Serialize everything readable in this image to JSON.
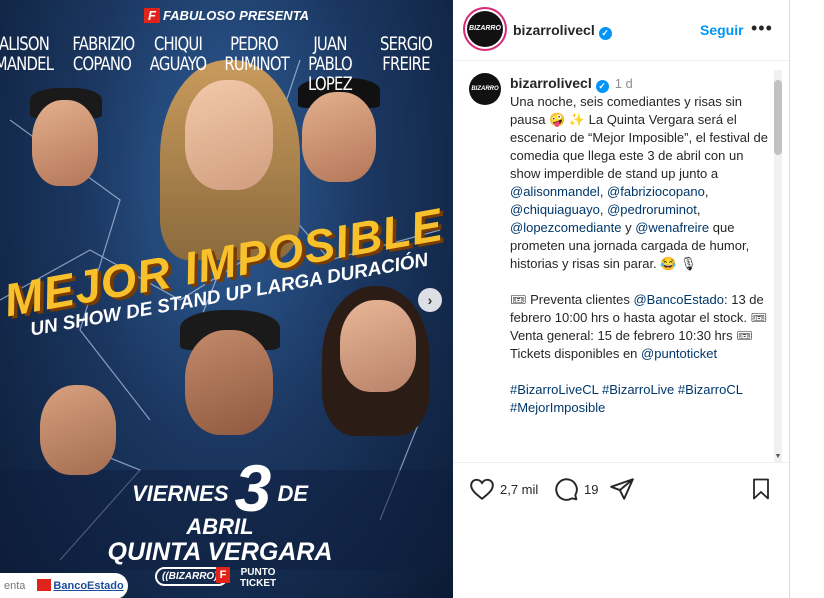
{
  "poster": {
    "sponsor_logo": "F",
    "sponsor_name": "FABULOSO",
    "sponsor_suffix": "PRESENTA",
    "comedians": [
      {
        "line1": "ALISON",
        "line2": "MANDEL"
      },
      {
        "line1": "FABRIZIO",
        "line2": "COPANO"
      },
      {
        "line1": "CHIQUI",
        "line2": "AGUAYO"
      },
      {
        "line1": "PEDRO",
        "line2": "RUMINOT"
      },
      {
        "line1": "JUAN PABLO",
        "line2": "LOPEZ"
      },
      {
        "line1": "SERGIO",
        "line2": "FREIRE"
      }
    ],
    "title": "MEJOR IMPOSIBLE",
    "subtitle": "UN SHOW DE STAND UP LARGA DURACIÓN",
    "date_day_name": "VIERNES",
    "date_number": "3",
    "date_month": "DE ABRIL",
    "venue": "QUINTA VERGARA",
    "sponsor_bar": {
      "entrance_text": "enta",
      "bank": "BancoEstado",
      "bizarro": "((BIZARRO))",
      "fabuloso_short": "F",
      "punto": "PUNTO",
      "ticket": "TICKET"
    },
    "next_arrow": "›"
  },
  "header": {
    "avatar_text": "BIZARRO",
    "username": "bizarrolivecl",
    "verified": "✓",
    "follow_label": "Seguir",
    "more": "•••"
  },
  "post": {
    "avatar_text": "BIZARRO",
    "username": "bizarrolivecl",
    "time": "1 d",
    "caption_intro": "Una noche, seis comediantes y risas sin pausa 🤪 ✨ La Quinta Vergara será el escenario de “Mejor Imposible”, el festival de comedia que llega este 3 de abril con un show imperdible de stand up junto a ",
    "mentions": [
      "@alisonmandel",
      "@fabriziocopano",
      "@chiquiaguayo",
      "@pedroruminot",
      "@lopezcomediante",
      "@wenafreire"
    ],
    "caption_sep": [
      ", ",
      ", ",
      ", ",
      ", ",
      " y ",
      ""
    ],
    "caption_outro": " que prometen una jornada cargada de humor, historias y risas sin parar. 😂 🎙",
    "presale_icon": "🎟",
    "presale_text": " Preventa clientes ",
    "presale_mention": "@BancoEstado",
    "presale_rest": ": 13 de febrero 10:00 hrs o hasta agotar el stock. ",
    "general_icon": "🎟",
    "general_text": " Venta general: 15 de febrero 10:30 hrs ",
    "tickets_icon": "🎟",
    "tickets_text": " Tickets disponibles en ",
    "tickets_mention": "@puntoticket",
    "hashtags": [
      "#BizarroLiveCL",
      "#BizarroLive",
      "#BizarroCL",
      "#MejorImposible"
    ],
    "scroll_down": "▼"
  },
  "actions": {
    "likes": "2,7 mil",
    "comments": "19"
  },
  "colors": {
    "accent": "#0095f6",
    "mention": "#00376b",
    "poster_yellow": "#f8c12c",
    "poster_bg": "#1b3761"
  }
}
